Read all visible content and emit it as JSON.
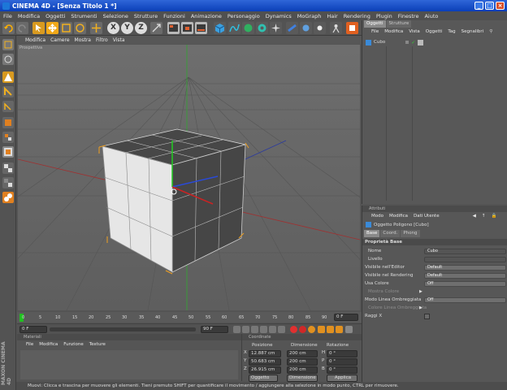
{
  "window": {
    "title": "CINEMA 4D - [Senza Titolo 1 *]"
  },
  "menu": [
    "File",
    "Modifica",
    "Oggetti",
    "Strumenti",
    "Selezione",
    "Strutture",
    "Funzioni",
    "Animazione",
    "Personaggio",
    "Dynamics",
    "MoGraph",
    "Hair",
    "Rendering",
    "Plugin",
    "Finestre",
    "Aiuto"
  ],
  "viewport": {
    "menu": [
      "Modifica",
      "Camere",
      "Mostra",
      "Filtro",
      "Vista"
    ],
    "label": "Prospettiva"
  },
  "toolbar": {
    "axis_labels": [
      "X",
      "Y",
      "Z"
    ]
  },
  "timeline": {
    "ticks": [
      "0",
      "5",
      "10",
      "15",
      "20",
      "25",
      "30",
      "35",
      "40",
      "45",
      "50",
      "55",
      "60",
      "65",
      "70",
      "75",
      "80",
      "85",
      "90"
    ],
    "current": "0 F"
  },
  "transport": {
    "start": "0 F",
    "end": "90 F"
  },
  "materials": {
    "title": "Materiali",
    "menu": [
      "File",
      "Modifica",
      "Funzione",
      "Texture"
    ]
  },
  "coords": {
    "title": "Coordinate",
    "headers": [
      "Posizione",
      "Dimensione",
      "Rotazione"
    ],
    "axes": [
      "X",
      "Y",
      "Z"
    ],
    "rot_axes": [
      "H",
      "P",
      "B"
    ],
    "position": [
      "12.887 cm",
      "50.683 cm",
      "26.915 cm"
    ],
    "size": [
      "200 cm",
      "200 cm",
      "200 cm"
    ],
    "rotation": [
      "0 °",
      "0 °",
      "0 °"
    ],
    "mode": "Oggetto",
    "size_mode": "Dimensione",
    "apply": "Applica"
  },
  "objects": {
    "tabs": [
      "Oggetti",
      "Strutture"
    ],
    "menu": [
      "File",
      "Modifica",
      "Vista",
      "Oggetti",
      "Tag",
      "Segnalibri"
    ],
    "items": [
      {
        "name": "Cubo"
      }
    ]
  },
  "attributes": {
    "title": "Attributi",
    "menu": [
      "Modo",
      "Modifica",
      "Dati Utente"
    ],
    "object_title": "Oggetto Poligono [Cubo]",
    "tabs": [
      "Base",
      "Coord.",
      "Phong"
    ],
    "section": "Proprietà Base",
    "rows": [
      {
        "label": "Nome",
        "value": "Cubo"
      },
      {
        "label": "Livello",
        "value": ""
      },
      {
        "label": "Visibile nell'Editor",
        "value": "Default"
      },
      {
        "label": "Visibile nel Rendering",
        "value": "Default"
      },
      {
        "label": "Usa Colore",
        "value": "Off"
      },
      {
        "label": "Mostra Colore",
        "value": ""
      },
      {
        "label": "Modo Linea Ombreggiata",
        "value": "Off"
      },
      {
        "label": "Colore Linea Ombreggiata",
        "value": ""
      },
      {
        "label": "Raggi X",
        "value": ""
      }
    ]
  },
  "status": "Muovi: Clicca e trascina per muovere gli elementi. Tieni premuto SHIFT per quantificare il movimento / aggiungere alla selezione in modo punto, CTRL per rimuovere.",
  "brand": "MAXON CINEMA 4D"
}
